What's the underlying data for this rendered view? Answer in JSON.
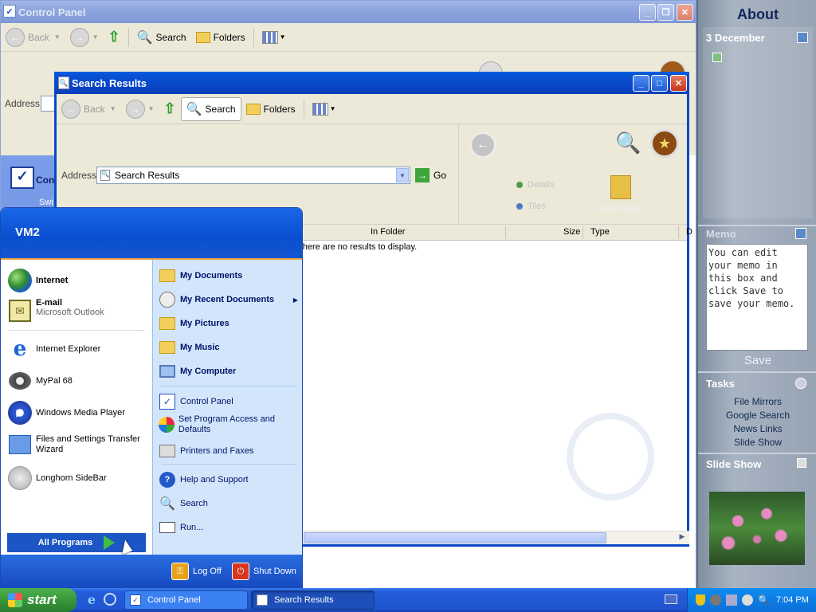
{
  "desktop": {
    "bg": "#3a6ea5"
  },
  "control_panel": {
    "title": "Control Panel",
    "toolbar": {
      "back": "Back",
      "search": "Search",
      "folders": "Folders"
    },
    "address_label": "Address",
    "left_panel_item": "Con",
    "left_panel_sub": "Swi"
  },
  "search_results": {
    "title": "Search Results",
    "toolbar": {
      "back": "Back",
      "search": "Search",
      "folders": "Folders"
    },
    "address_label": "Address",
    "address_value": "Search Results",
    "go_label": "Go",
    "extra": {
      "details": "Details",
      "tiles": "Tiles",
      "new_folder": "New folder"
    },
    "columns": [
      "In Folder",
      "Size",
      "Type",
      "D"
    ],
    "empty_message": "There are no results to display."
  },
  "start_menu": {
    "user": "VM2",
    "left_items": [
      {
        "label": "Internet",
        "sub": "",
        "bold": true,
        "icon": "globe-icon"
      },
      {
        "label": "E-mail",
        "sub": "Microsoft Outlook",
        "bold": true,
        "icon": "outlook-icon"
      },
      {
        "label": "Internet Explorer",
        "sub": "",
        "bold": false,
        "icon": "ie-icon"
      },
      {
        "label": "MyPal 68",
        "sub": "",
        "bold": false,
        "icon": "raccoon-icon"
      },
      {
        "label": "Windows Media Player",
        "sub": "",
        "bold": false,
        "icon": "media-player-icon"
      },
      {
        "label": "Files and Settings Transfer Wizard",
        "sub": "",
        "bold": false,
        "icon": "transfer-wizard-icon"
      },
      {
        "label": "Longhorn SideBar",
        "sub": "",
        "bold": false,
        "icon": "sidebar-icon"
      }
    ],
    "all_programs": "All Programs",
    "right_items": [
      {
        "label": "My Documents",
        "bold": true
      },
      {
        "label": "My Recent Documents",
        "bold": true
      },
      {
        "label": "My Pictures",
        "bold": true
      },
      {
        "label": "My Music",
        "bold": true
      },
      {
        "label": "My Computer",
        "bold": true
      },
      {
        "label": "Control Panel",
        "bold": false
      },
      {
        "label": "Set Program Access and Defaults",
        "bold": false
      },
      {
        "label": "Printers and Faxes",
        "bold": false
      },
      {
        "label": "Help and Support",
        "bold": false
      },
      {
        "label": "Search",
        "bold": false
      },
      {
        "label": "Run...",
        "bold": false
      }
    ],
    "log_off": "Log Off",
    "shut_down": "Shut Down"
  },
  "sidebar": {
    "title": "About",
    "date": "3 December",
    "memo_title": "Memo",
    "memo_text": "You can edit your memo in this box and click Save to save your memo.",
    "save": "Save",
    "tasks_title": "Tasks",
    "tasks": [
      "File Mirrors",
      "Google Search",
      "News Links",
      "Slide Show"
    ],
    "slideshow_title": "Slide Show"
  },
  "taskbar": {
    "start": "start",
    "tasks": [
      "Control Panel",
      "Search Results"
    ],
    "clock": "7:04 PM"
  }
}
